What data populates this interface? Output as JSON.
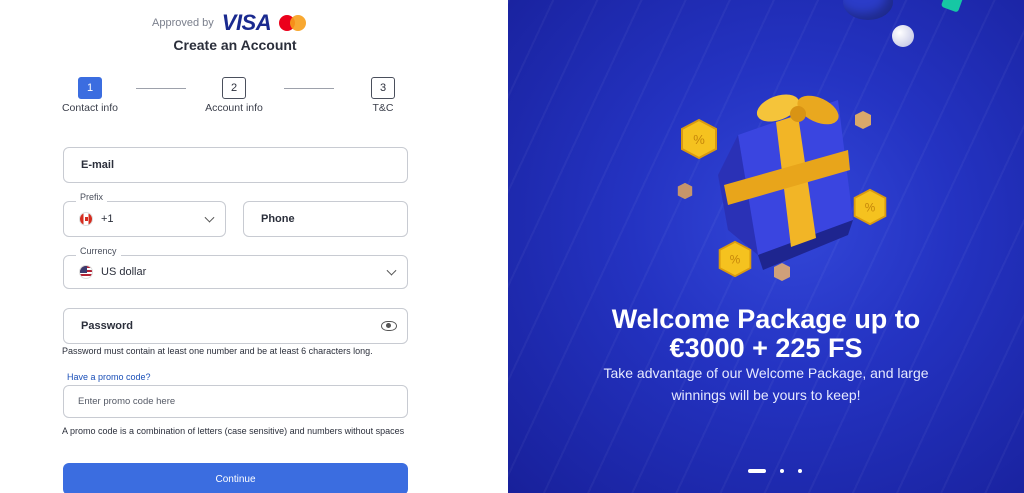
{
  "header": {
    "approved_by": "Approved by",
    "visa": "VISA",
    "title": "Create an Account"
  },
  "steps": [
    {
      "num": "1",
      "label": "Contact info",
      "active": true
    },
    {
      "num": "2",
      "label": "Account info",
      "active": false
    },
    {
      "num": "3",
      "label": "T&C",
      "active": false
    }
  ],
  "form": {
    "email_label": "E-mail",
    "prefix_label": "Prefix",
    "prefix_value": "+1",
    "phone_label": "Phone",
    "currency_label": "Currency",
    "currency_value": "US dollar",
    "password_label": "Password",
    "password_hint": "Password must contain at least one number and be at least 6 characters long.",
    "promo_link": "Have a promo code?",
    "promo_placeholder": "Enter promo code here",
    "promo_hint": "A promo code is a combination of letters (case sensitive) and numbers without spaces",
    "continue_label": "Continue"
  },
  "promo_panel": {
    "headline_line1": "Welcome Package up to",
    "headline_line2": "€3000 + 225 FS",
    "sub_line1": "Take advantage of our Welcome Package, and large",
    "sub_line2": "winnings will be yours to keep!",
    "carousel_pages": 3,
    "carousel_active_index": 0,
    "coin_symbol": "%"
  },
  "colors": {
    "accent": "#3b6de0",
    "panel_bg": "#2433c2",
    "gift": "#3a45e0",
    "ribbon": "#f2b526"
  }
}
